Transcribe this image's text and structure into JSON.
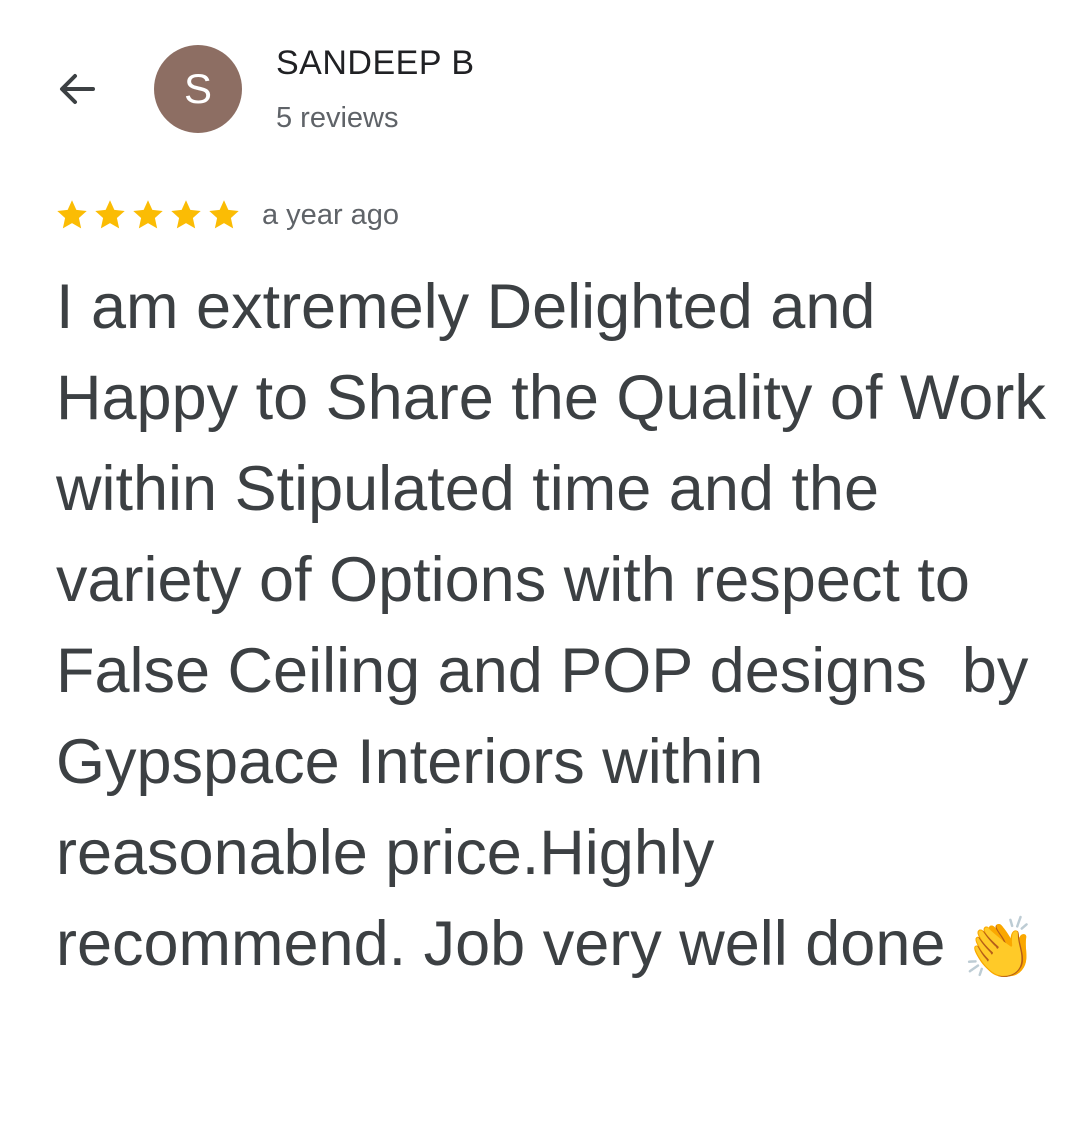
{
  "header": {
    "back_icon": "arrow-left-icon",
    "avatar_letter": "S",
    "avatar_color": "#8d6e63",
    "author_name": "SANDEEP B",
    "review_count": "5 reviews"
  },
  "review": {
    "rating": 5,
    "max_rating": 5,
    "star_color": "#fbbc04",
    "time_ago": "a year ago",
    "text": "I am extremely Delighted and Happy to Share the Quality of Work within Stipulated time and the variety of Options with respect to False Ceiling and POP designs  by Gypspace Interiors within reasonable price.Highly recommend. Job very well done ",
    "emoji": "👏",
    "emoji_icon": "clapping-hands-icon"
  }
}
